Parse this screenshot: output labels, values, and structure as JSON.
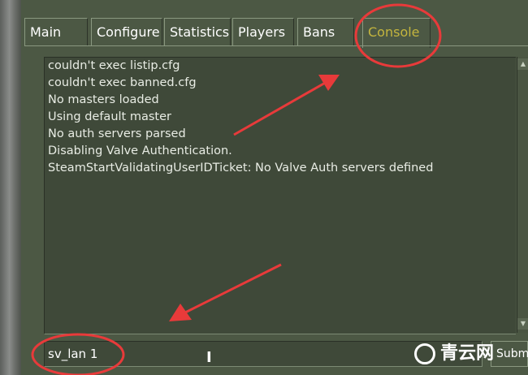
{
  "tabs": [
    {
      "label": "Main",
      "active": false
    },
    {
      "label": "Configure",
      "active": false
    },
    {
      "label": "Statistics",
      "active": false
    },
    {
      "label": "Players",
      "active": false
    },
    {
      "label": "Bans",
      "active": false
    },
    {
      "label": "Console",
      "active": true
    }
  ],
  "console": {
    "lines": [
      "couldn't exec listip.cfg",
      "couldn't exec banned.cfg",
      "No masters loaded",
      "Using default master",
      "No auth servers parsed",
      "Disabling Valve Authentication.",
      "SteamStartValidatingUserIDTicket:  No Valve Auth servers defined"
    ]
  },
  "command": {
    "value": "sv_lan 1"
  },
  "submit_label": "Subm",
  "watermark": {
    "text": "青云网"
  },
  "colors": {
    "panel": "#4c5844",
    "active_tab_text": "#c4b53e",
    "annotation_red": "#e83a3a"
  }
}
